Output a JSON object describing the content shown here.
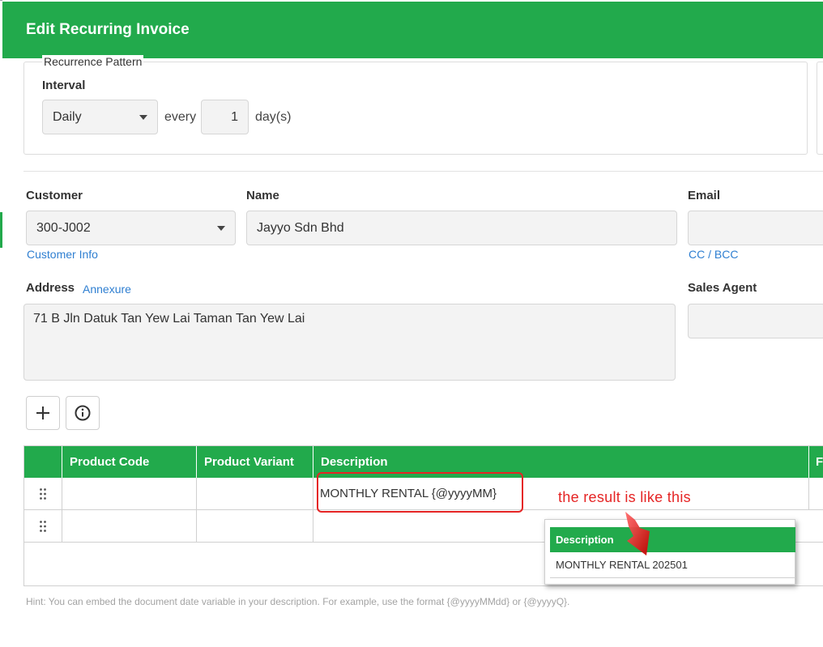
{
  "dialog": {
    "title": "Edit Recurring Invoice"
  },
  "recurrence": {
    "legend": "Recurrence Pattern",
    "interval_label": "Interval",
    "interval_value": "Daily",
    "every_label": "every",
    "every_value": "1",
    "unit_label": "day(s)"
  },
  "customer": {
    "label": "Customer",
    "value": "300-J002",
    "info_link": "Customer Info"
  },
  "name": {
    "label": "Name",
    "value": "Jayyo Sdn Bhd"
  },
  "email": {
    "label": "Email",
    "value": "",
    "cc_bcc_link": "CC / BCC"
  },
  "address": {
    "label": "Address",
    "annexure_link": "Annexure",
    "value": "71 B Jln Datuk Tan Yew Lai Taman Tan Yew Lai"
  },
  "sales_agent": {
    "label": "Sales Agent",
    "value": ""
  },
  "table": {
    "columns": [
      "Product Code",
      "Product Variant",
      "Description",
      "F"
    ],
    "rows": [
      {
        "product_code": "",
        "product_variant": "",
        "description": "MONTHLY RENTAL {@yyyyMM}"
      },
      {
        "product_code": "",
        "product_variant": "",
        "description": ""
      }
    ]
  },
  "annotation": {
    "text": "the result is like this"
  },
  "result_preview": {
    "header": "Description",
    "value": "MONTHLY RENTAL 202501"
  },
  "hint": "Hint: You can embed the document date variable in your description. For example, use the format {@yyyyMMdd} or {@yyyyQ}.",
  "colors": {
    "brand_green": "#22aa4c",
    "link_blue": "#2f7fd1",
    "annotation_red": "#e52424"
  }
}
